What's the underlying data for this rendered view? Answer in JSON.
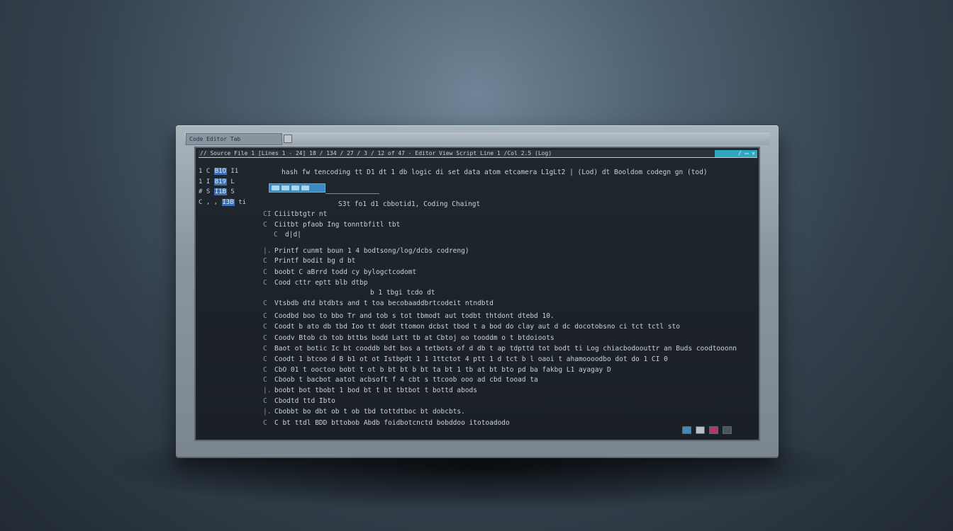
{
  "window": {
    "title": "Code Editor Tab",
    "header_text": "// Source File 1 [Lines 1 - 24] 18 / 134 / 27 / 3 / 12 of 47  - Editor View Script  Line 1 /Col 2.5 (Log)",
    "header_buttons": "/ ▭ ✕"
  },
  "gutter": {
    "rows": [
      {
        "a": "1 C",
        "b": "B1O",
        "c": "I1"
      },
      {
        "a": "1 I",
        "b": "B19",
        "c": "L"
      },
      {
        "a": "# S",
        "b": "I1B",
        "c": "S"
      },
      {
        "a": "C , ,",
        "b": "I3B",
        "c": "ti"
      }
    ]
  },
  "code_lines": [
    {
      "c": "",
      "t": "hash fw tencoding tt D1 dt 1 db logic di set data atom etcamera L1gLt2 | (Lod) dt Booldom codegn gn (tod)"
    },
    {
      "c": "",
      "t": "S3t fo1 d1 cbbotid1, Coding  Chaingt"
    },
    {
      "c": "CI",
      "t": "Ciiitbtgtr   nt"
    },
    {
      "c": "C",
      "t": "Ciitbt  pfaob  Ing  tonntbfitl  tbt"
    },
    {
      "c": "C",
      "t": "d|d|"
    },
    {
      "c": "|.",
      "t": "Printf  cunmt boun 1 4 bodtsong/log/dcbs codreng)"
    },
    {
      "c": "C",
      "t": "Printf  bodit bg d  bt"
    },
    {
      "c": "C",
      "t": "boobt C  aBrrd todd  cy bylogctcodomt"
    },
    {
      "c": "C",
      "t": "Cood cttr eptt  blb dtbp"
    },
    {
      "c": "",
      "t": "b 1 tbgi tcdo dt"
    },
    {
      "c": "C",
      "t": "Vtsbdb  dtd  btdbts and t toa  becobaaddbrtcodeit ntndbtd"
    },
    {
      "c": "C",
      "t": "Coodbd  boo to bbo Tr and tob  s tot  tbmodt aut todbt thtdont dtebd 10."
    },
    {
      "c": "C",
      "t": "Coodt b  ato db tbd Ioo tt dodt ttomon  dcbst tbod t a bod do clay aut d  dc docotobsno ci tct tctl sto"
    },
    {
      "c": "C",
      "t": "Coodv  Btob  cb  tob bttbs  bodd Latt  tb at  Cbtoj  oo  tooddm o t  btdoioots"
    },
    {
      "c": "C",
      "t": "Baot ot  botic Ic bt cooddb bdt bos a  tetbots of d db t ap  tdpttd tot bodt ti Log chiacbodoouttr an   Buds coodtooonn"
    },
    {
      "c": "C",
      "t": "Coodt 1 btcoo  d B b1 ot  ot  Istbpdt 1 1 1ttctot  4 ptt 1 d tct  b l  oaoi t ahamoooodbo dot do 1 CI  0"
    },
    {
      "c": "C",
      "t": "CbO  01  t  ooctoo  bobt t  ot  b bt bt b bt ta  bt  1 tb at bt  bto pd ba  fakbg L1 ayagay D"
    },
    {
      "c": "C",
      "t": "Cboob t  bacbot aatot  acbsoft f 4  cbt s ttcoob ooo ad cbd tooad ta"
    },
    {
      "c": "|.",
      "t": "boobt  bot  tbobt  1 bod  bt t  bt tbtbot t  bottd abods"
    },
    {
      "c": "C",
      "t": "Cbodtd  ttd          Ibto"
    },
    {
      "c": "|.",
      "t": "Cbobbt  bo dbt  ob t ob tbd tottdtboc  bt dobcbts."
    },
    {
      "c": "C",
      "t": "C bt ttdl BDD bttobob  Abdb  foidbotcnctd  bobddoo  itotoadodo"
    }
  ],
  "status": {
    "icons": [
      "monitor-icon",
      "window-icon",
      "record-icon",
      "settings-icon"
    ],
    "colors": {
      "accent": "#2ea7c2",
      "highlight": "#3b6fb0",
      "record": "#c0325a"
    }
  }
}
